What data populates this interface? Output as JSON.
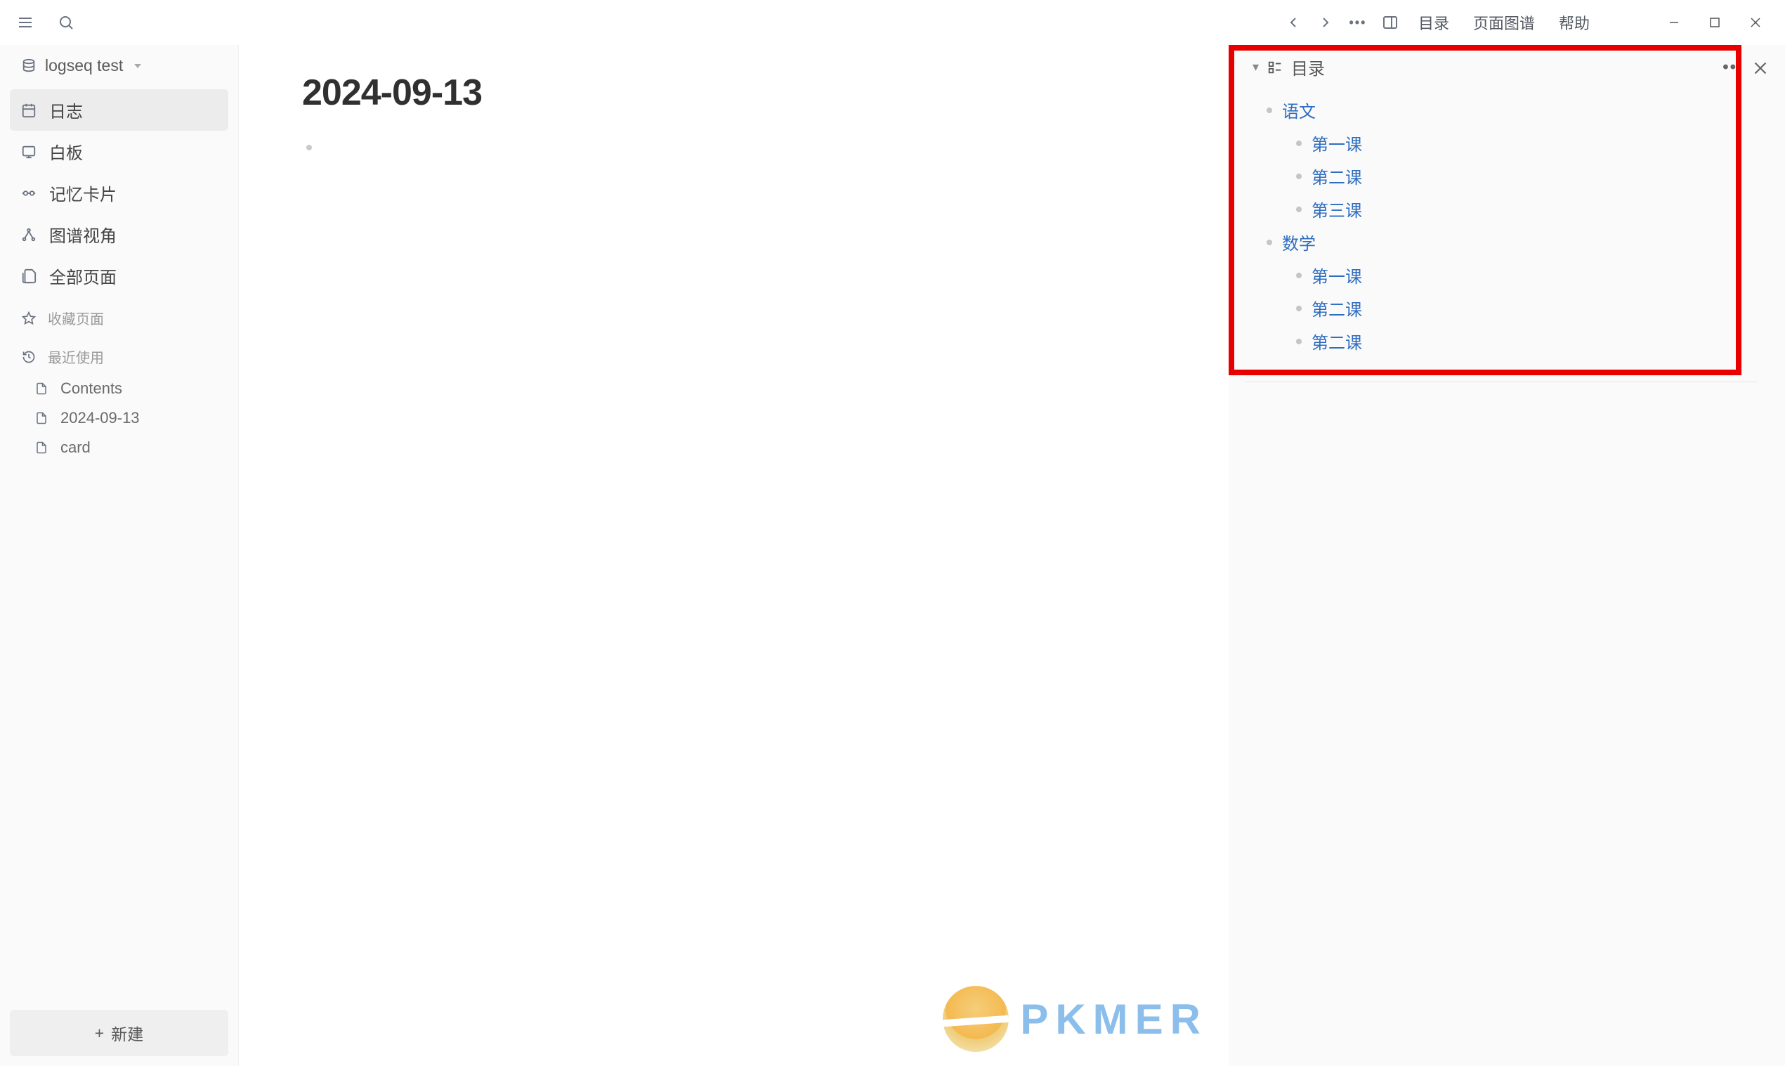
{
  "titlebar": {
    "menus": [
      "目录",
      "页面图谱",
      "帮助"
    ]
  },
  "sidebar": {
    "graph_name": "logseq test",
    "nav": [
      {
        "id": "journals",
        "label": "日志",
        "active": true
      },
      {
        "id": "whiteboards",
        "label": "白板",
        "active": false
      },
      {
        "id": "flashcards",
        "label": "记忆卡片",
        "active": false
      },
      {
        "id": "graph-view",
        "label": "图谱视角",
        "active": false
      },
      {
        "id": "all-pages",
        "label": "全部页面",
        "active": false
      }
    ],
    "favorites_header": "收藏页面",
    "recent_header": "最近使用",
    "recent": [
      "Contents",
      "2024-09-13",
      "card"
    ],
    "new_button": "新建"
  },
  "main": {
    "page_title": "2024-09-13"
  },
  "right_panel": {
    "toc_title": "目录",
    "toc": [
      {
        "level": 1,
        "text": "语文"
      },
      {
        "level": 2,
        "text": "第一课"
      },
      {
        "level": 2,
        "text": "第二课"
      },
      {
        "level": 2,
        "text": "第三课"
      },
      {
        "level": 1,
        "text": "数学"
      },
      {
        "level": 2,
        "text": "第一课"
      },
      {
        "level": 2,
        "text": "第二课"
      },
      {
        "level": 2,
        "text": "第二课"
      }
    ]
  },
  "watermark": "PKMER"
}
